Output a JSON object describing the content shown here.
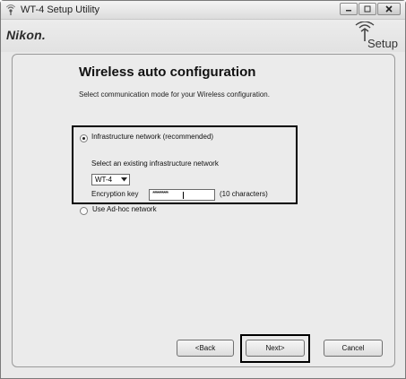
{
  "window": {
    "title": "WT-4 Setup Utility"
  },
  "header": {
    "brand": "Nikon.",
    "setup_label": "Setup",
    "setup_icon": "antenna-icon"
  },
  "panel": {
    "heading": "Wireless auto configuration",
    "subtext": "Select communication mode for your Wireless configuration."
  },
  "options": {
    "infrastructure": {
      "label": "Infrastructure network (recommended)",
      "checked": true
    },
    "select_network_label": "Select an existing infrastructure network",
    "network_dropdown": {
      "value": "WT-4"
    },
    "encryption_key": {
      "label": "Encryption key",
      "value": "**********",
      "hint": "(10 characters)"
    },
    "adhoc": {
      "label": "Use Ad-hoc network",
      "checked": false
    }
  },
  "buttons": {
    "back": "<Back",
    "next": "Next>",
    "cancel": "Cancel"
  }
}
